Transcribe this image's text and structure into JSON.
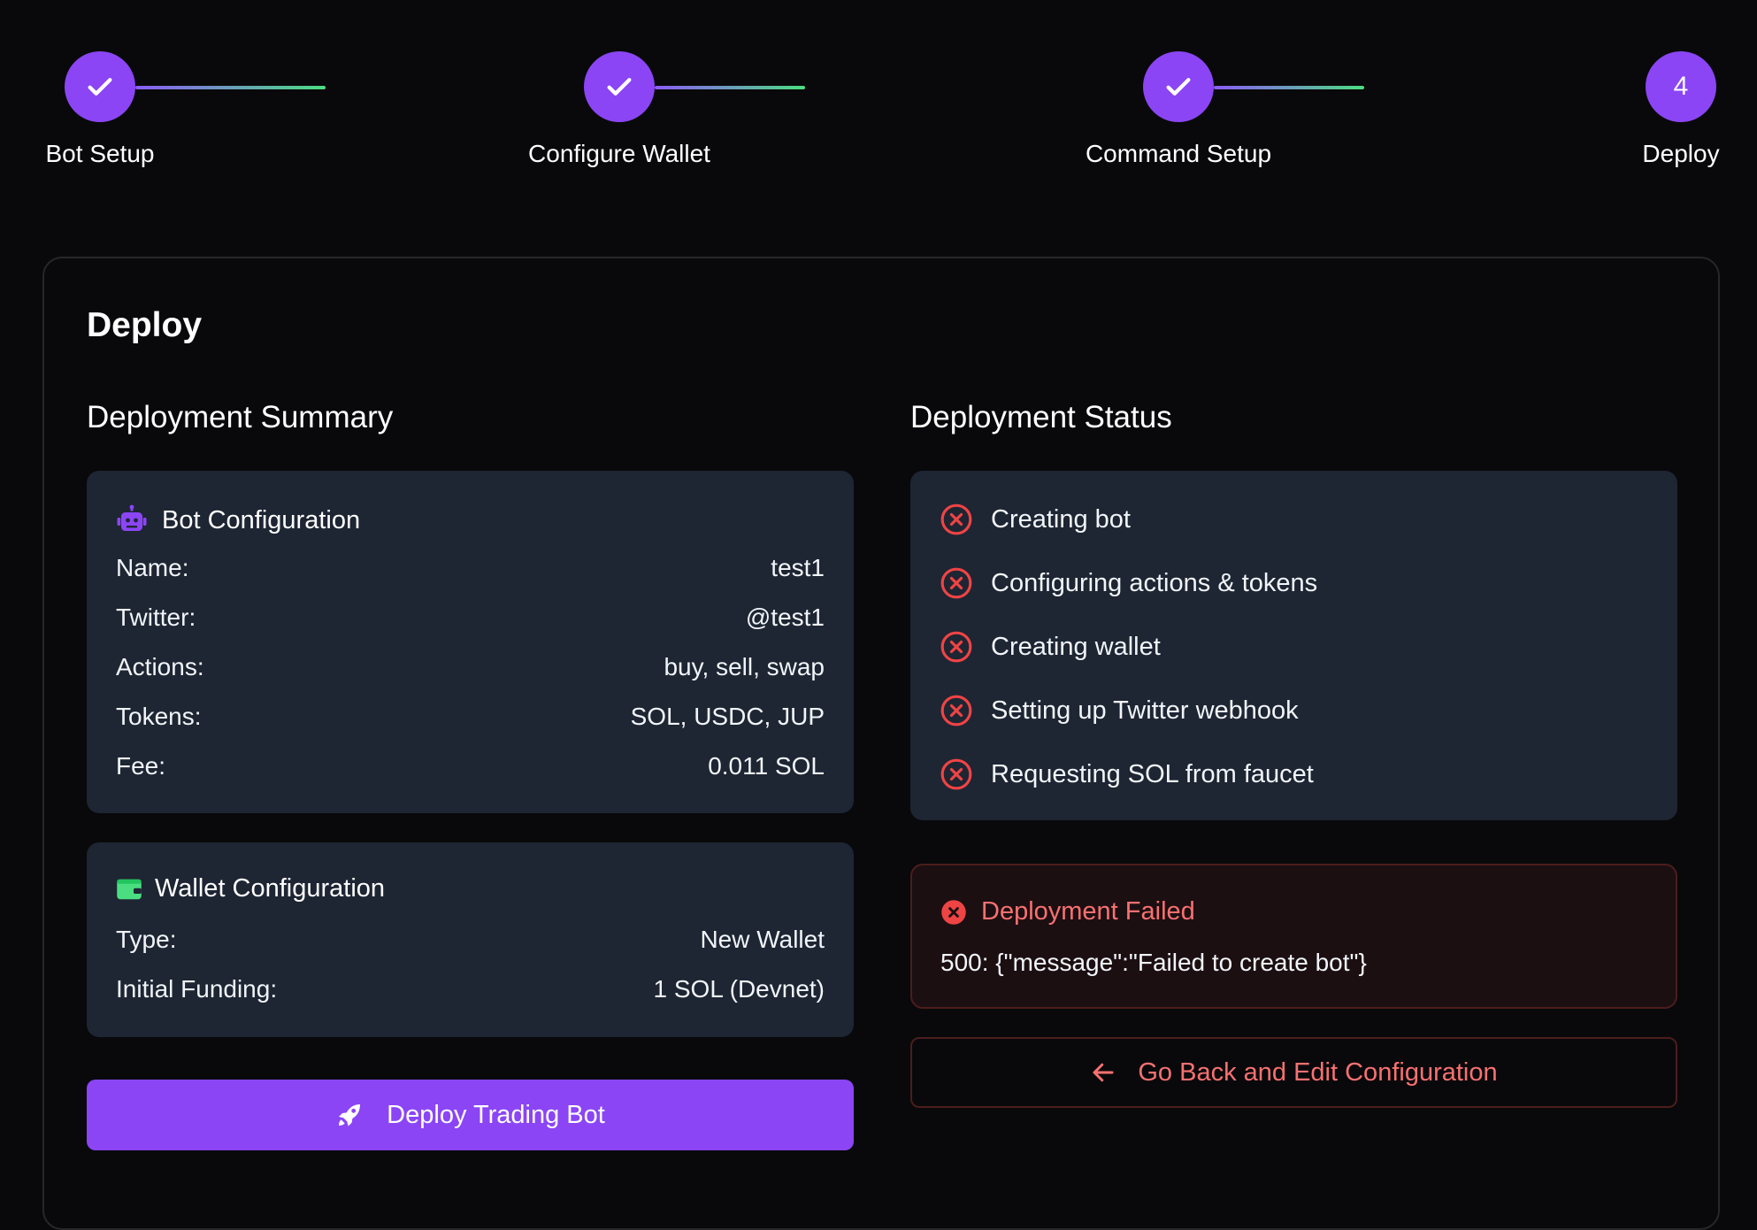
{
  "stepper": {
    "steps": [
      {
        "label": "Bot Setup",
        "state": "completed"
      },
      {
        "label": "Configure Wallet",
        "state": "completed"
      },
      {
        "label": "Command Setup",
        "state": "completed"
      },
      {
        "label": "Deploy",
        "state": "current",
        "number": "4"
      }
    ]
  },
  "card": {
    "title": "Deploy"
  },
  "summary": {
    "title": "Deployment Summary",
    "bot_config": {
      "header": "Bot Configuration",
      "icon": "robot-icon",
      "rows": [
        {
          "label": "Name:",
          "value": "test1"
        },
        {
          "label": "Twitter:",
          "value": "@test1"
        },
        {
          "label": "Actions:",
          "value": "buy, sell, swap"
        },
        {
          "label": "Tokens:",
          "value": "SOL, USDC, JUP"
        },
        {
          "label": "Fee:",
          "value": "0.011 SOL"
        }
      ]
    },
    "wallet_config": {
      "header": "Wallet Configuration",
      "icon": "wallet-icon",
      "rows": [
        {
          "label": "Type:",
          "value": "New Wallet"
        },
        {
          "label": "Initial Funding:",
          "value": "1 SOL (Devnet)"
        }
      ]
    },
    "deploy_button": "Deploy Trading Bot"
  },
  "status": {
    "title": "Deployment Status",
    "items": [
      {
        "label": "Creating bot",
        "state": "failed"
      },
      {
        "label": "Configuring actions & tokens",
        "state": "failed"
      },
      {
        "label": "Creating wallet",
        "state": "failed"
      },
      {
        "label": "Setting up Twitter webhook",
        "state": "failed"
      },
      {
        "label": "Requesting SOL from faucet",
        "state": "failed"
      }
    ],
    "error": {
      "title": "Deployment Failed",
      "message": "500: {\"message\":\"Failed to create bot\"}"
    },
    "back_button": "Go Back and Edit Configuration"
  },
  "colors": {
    "accent": "#8b45f5",
    "error": "#f87171",
    "success": "#4ade80",
    "panel": "#1e2533",
    "background": "#09090b"
  }
}
